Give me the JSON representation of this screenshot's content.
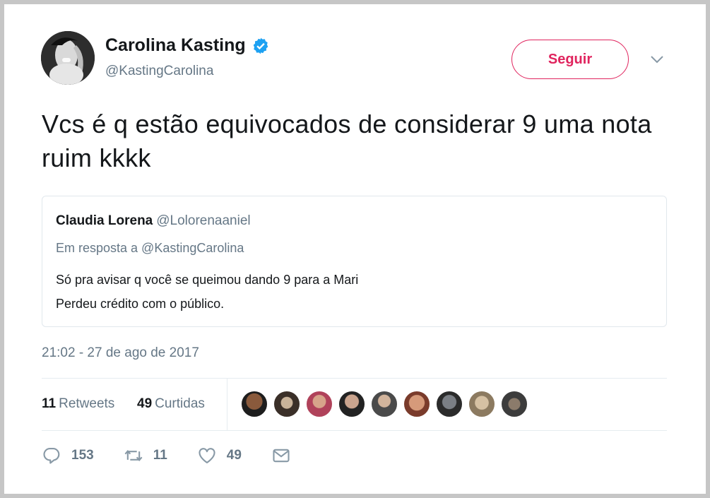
{
  "author": {
    "name": "Carolina Kasting",
    "handle": "@KastingCarolina",
    "verified": true
  },
  "header": {
    "follow_label": "Seguir"
  },
  "tweet": {
    "text": "Vcs é q estão equivocados de considerar 9 uma nota ruim kkkk",
    "timestamp": "21:02 - 27 de ago de 2017"
  },
  "quoted": {
    "name": "Claudia Lorena",
    "handle": "@Lolorenaaniel",
    "reply_to": "Em resposta a @KastingCarolina",
    "lines": [
      "Só pra avisar q você se queimou dando 9 para a Mari",
      "Perdeu crédito com o público."
    ]
  },
  "stats": {
    "retweets_count": "11",
    "retweets_label": "Retweets",
    "likes_count": "49",
    "likes_label": "Curtidas"
  },
  "actions": {
    "replies": "153",
    "retweets": "11",
    "likes": "49"
  },
  "colors": {
    "accent": "#e0245e",
    "verified": "#1da1f2",
    "muted": "#657786"
  },
  "icons": [
    "verified-badge-icon",
    "chevron-down-icon",
    "reply-icon",
    "retweet-icon",
    "like-icon",
    "message-icon"
  ]
}
